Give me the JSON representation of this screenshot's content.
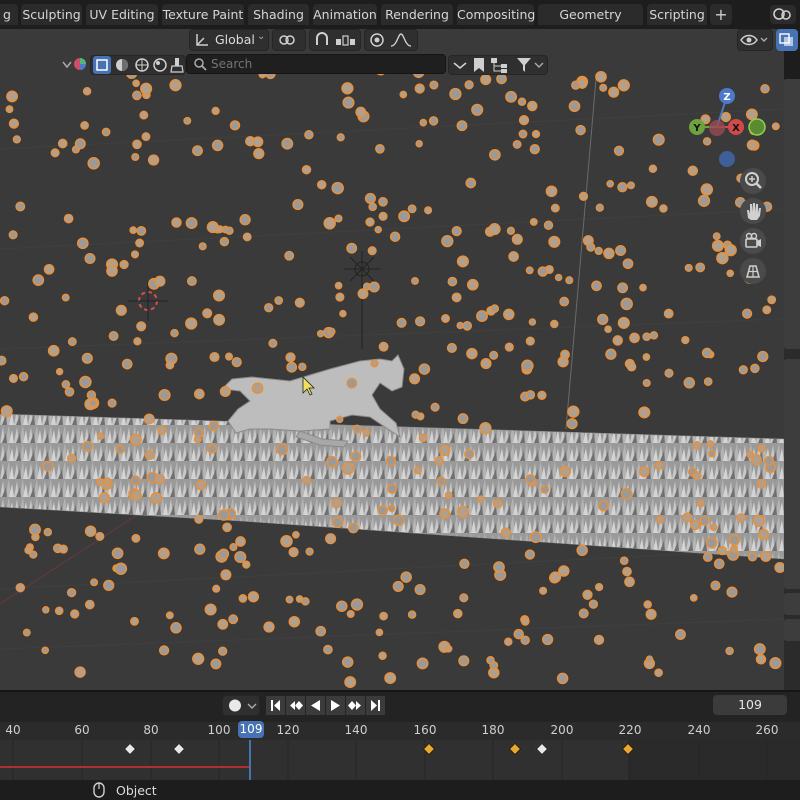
{
  "workspace_tabs": [
    "g",
    "Sculpting",
    "UV Editing",
    "Texture Paint",
    "Shading",
    "Animation",
    "Rendering",
    "Compositing",
    "Geometry Nodes",
    "Scripting"
  ],
  "add_workspace_label": "+",
  "viewport_header": {
    "transform_orientation": "Global",
    "search_placeholder": "Search"
  },
  "gizmo": {
    "z_label": "Z",
    "y_label": "Y",
    "x_label": "X"
  },
  "timeline": {
    "current_frame": "109",
    "ruler_ticks": [
      "40",
      "60",
      "80",
      "100",
      "120",
      "140",
      "160",
      "180",
      "200",
      "220",
      "240",
      "260"
    ],
    "current_frame_label": "109"
  },
  "statusbar": {
    "mode_label": "Object"
  },
  "colors": {
    "accent_blue": "#4772b3",
    "selection_orange": "#e8903a",
    "keyframe_white": "#e8e8e8",
    "keyframe_orange": "#e8a830"
  },
  "icons": [
    "orientation-icon",
    "snap-icon",
    "proportional-icon",
    "overlay-icon",
    "gizmo-icon",
    "zoom-icon",
    "hand-icon",
    "camera-icon",
    "grid-icon",
    "filter-icon"
  ]
}
